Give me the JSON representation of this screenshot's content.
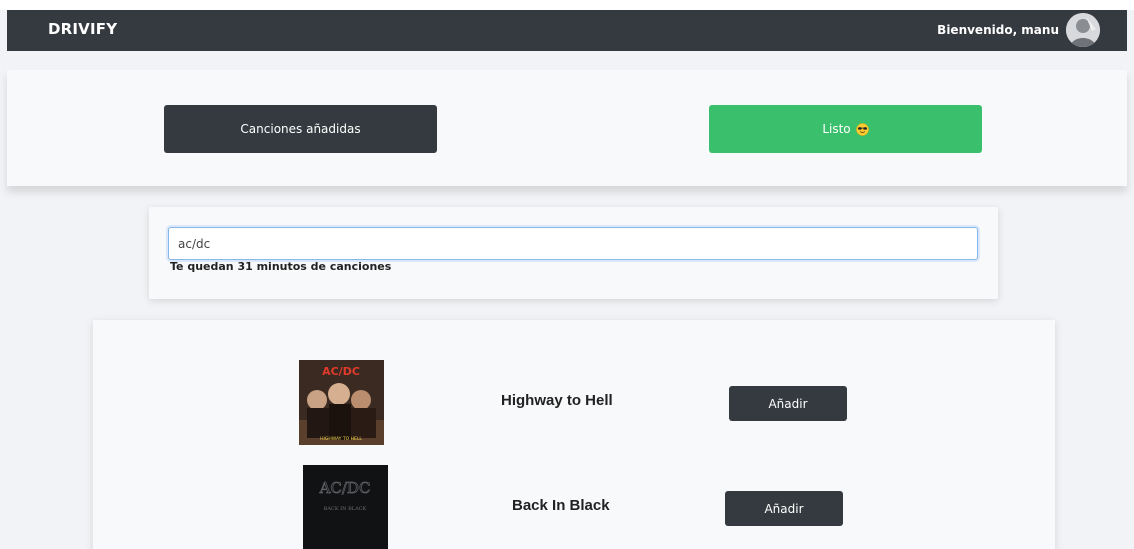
{
  "navbar": {
    "brand": "DRIVIFY",
    "welcome": "Bienvenido, manu",
    "avatar_icon": "user-avatar"
  },
  "actions": {
    "added_label": "Canciones añadidas",
    "done_label": "Listo",
    "done_icon": "sunglasses-emoji-icon"
  },
  "search": {
    "value": "ac/dc",
    "minutes_text": "Te quedan 31 minutos de canciones"
  },
  "colors": {
    "navbar": "#343a40",
    "success": "#3ac06d",
    "page_bg": "#f1f3f6",
    "card_bg": "#f8f9fa"
  },
  "results": [
    {
      "title": "Highway to Hell",
      "add_label": "Añadir",
      "cover_text": "AC/DC",
      "cover_sub": "HIGHWAY TO HELL"
    },
    {
      "title": "Back In Black",
      "add_label": "Añadir",
      "cover_text": "AC/DC",
      "cover_sub": "BACK IN BLACK"
    }
  ]
}
